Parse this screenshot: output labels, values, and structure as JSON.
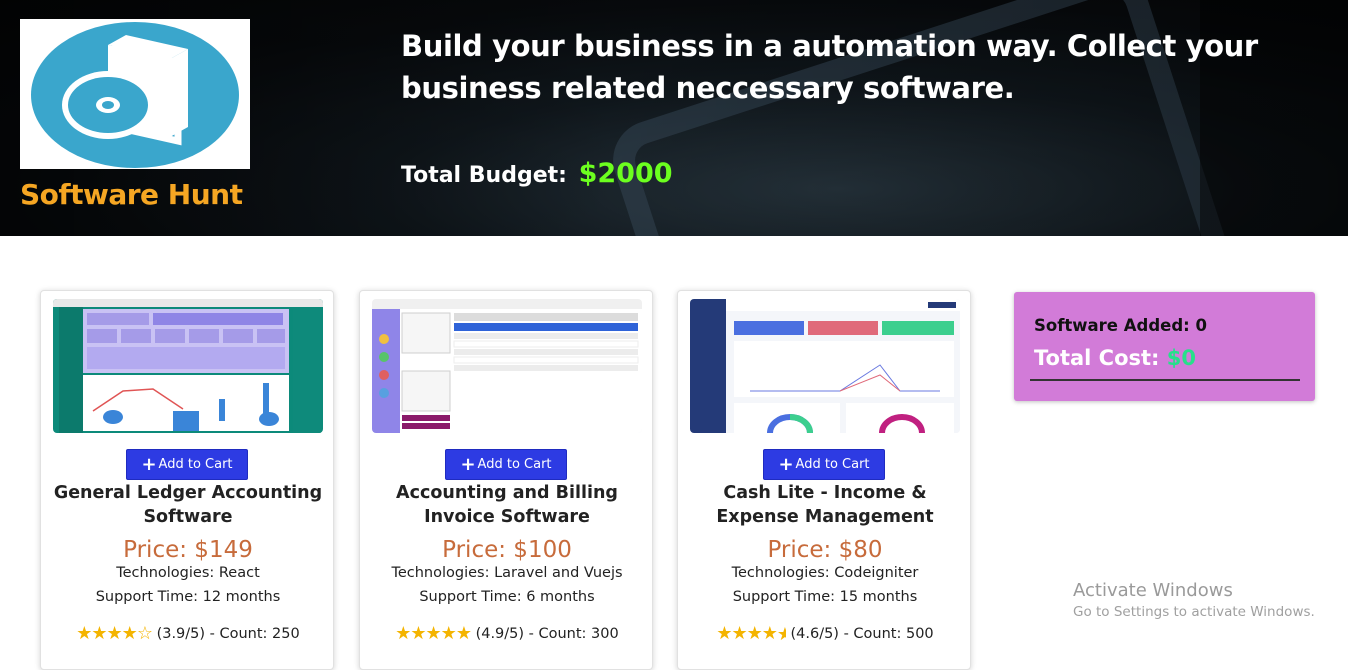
{
  "brand": {
    "name": "Software Hunt",
    "logo_icon": "software-box-disc-icon"
  },
  "header": {
    "tagline": "Build your business in a automation way. Collect your business related neccessary software.",
    "budget_label": "Total Budget:",
    "budget_amount": "$2000"
  },
  "products": [
    {
      "name": "General Ledger Accounting Software",
      "add_label": "Add to Cart",
      "price": "Price: $149",
      "technologies": "Technologies: React",
      "support": "Support Time: 12 months",
      "rating_value": 3.9,
      "rating_text": "(3.9/5) - Count: 250"
    },
    {
      "name": "Accounting and Billing Invoice Software",
      "add_label": "Add to Cart",
      "price": "Price: $100",
      "technologies": "Technologies: Laravel and Vuejs",
      "support": "Support Time: 6 months",
      "rating_value": 4.9,
      "rating_text": "(4.9/5) - Count: 300"
    },
    {
      "name": "Cash Lite - Income & Expense Management",
      "add_label": "Add to Cart",
      "price": "Price: $80",
      "technologies": "Technologies: Codeigniter",
      "support": "Support Time: 15 months",
      "rating_value": 4.6,
      "rating_text": "(4.6/5) - Count: 500"
    }
  ],
  "cart": {
    "added_label": "Software Added: 0",
    "cost_label": "Total Cost:",
    "cost_amount": "$0"
  },
  "watermark": {
    "title": "Activate Windows",
    "subtitle": "Go to Settings to activate Windows."
  },
  "colors": {
    "brand": "#f5a623",
    "budget": "#6cff1f",
    "button": "#2d3be3",
    "price": "#c76b3b",
    "cart_bg": "#d27bd8",
    "cart_cost": "#27e08a",
    "star": "#f4b400"
  }
}
